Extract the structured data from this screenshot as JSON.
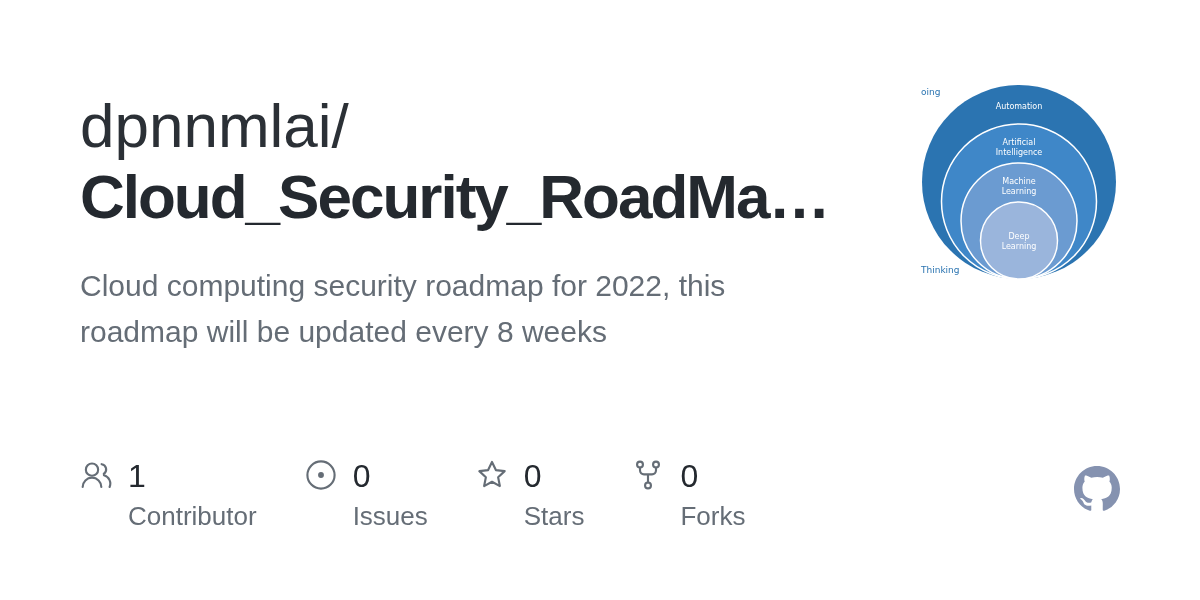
{
  "repo": {
    "owner": "dpnnmlai/",
    "name": "Cloud_Security_RoadMa…",
    "description": "Cloud computing security roadmap for 2022, this roadmap will be updated every 8 weeks"
  },
  "preview": {
    "side_labels": [
      "oing",
      "Thinking"
    ],
    "rings": [
      {
        "label": "Automation",
        "color": "#2b74b1"
      },
      {
        "label": "Artificial Intelligence",
        "color": "#3f87c8"
      },
      {
        "label": "Machine Learning",
        "color": "#6b9bd1"
      },
      {
        "label": "Deep Learning",
        "color": "#9ab5dc"
      }
    ]
  },
  "stats": [
    {
      "kind": "contributors",
      "count": "1",
      "label": "Contributor"
    },
    {
      "kind": "issues",
      "count": "0",
      "label": "Issues"
    },
    {
      "kind": "stars",
      "count": "0",
      "label": "Stars"
    },
    {
      "kind": "forks",
      "count": "0",
      "label": "Forks"
    }
  ]
}
